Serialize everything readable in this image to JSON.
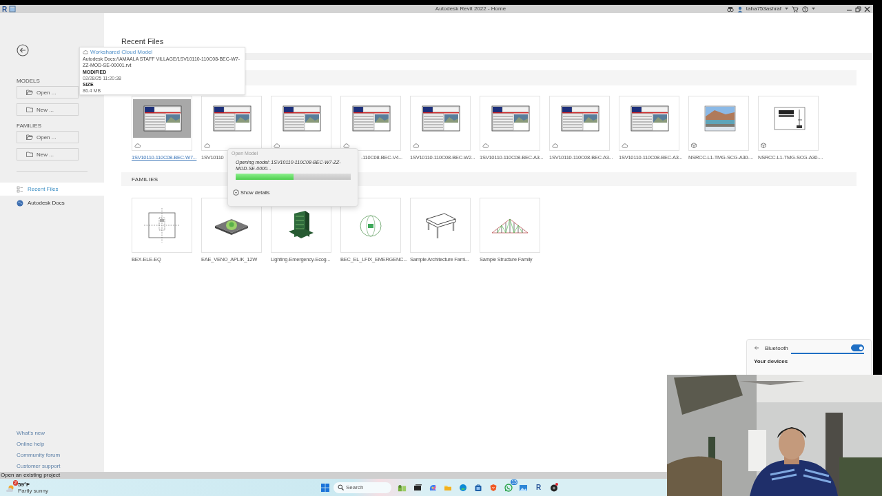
{
  "title_bar": {
    "app_icon": "R",
    "title": "Autodesk Revit 2022 - Home",
    "user": "taha753ashraf"
  },
  "sidebar": {
    "sections": [
      {
        "heading": "MODELS",
        "buttons": [
          {
            "label": "Open ...",
            "kind": "open"
          },
          {
            "label": "New ...",
            "kind": "new"
          }
        ]
      },
      {
        "heading": "FAMILIES",
        "buttons": [
          {
            "label": "Open ...",
            "kind": "open"
          },
          {
            "label": "New ...",
            "kind": "new"
          }
        ]
      }
    ],
    "nav": [
      {
        "label": "Recent Files",
        "selected": true,
        "kind": "recent"
      },
      {
        "label": "Autodesk Docs",
        "selected": false,
        "kind": "docs"
      }
    ],
    "links": [
      "What's new",
      "Online help",
      "Community forum",
      "Customer support"
    ]
  },
  "main": {
    "title": "Recent Files",
    "models": [
      {
        "label": "1SV10110-110C08-BEC-W7...",
        "selected": true,
        "kind": "sheet",
        "cloud": true
      },
      {
        "label": "1SV10110",
        "selected": false,
        "kind": "sheet",
        "cloud": true
      },
      {
        "selected": false,
        "kind": "sheet",
        "cloud": true
      },
      {
        "label": "-110C08-BEC-V4...",
        "selected": false,
        "kind": "sheet",
        "cloud": true
      },
      {
        "label": "1SV10110-110C08-BEC-W2...",
        "selected": false,
        "kind": "sheet",
        "cloud": true
      },
      {
        "label": "1SV10110-110C08-BEC-A3...",
        "selected": false,
        "kind": "sheet",
        "cloud": true
      },
      {
        "label": "1SV10110-110C08-BEC-A3...",
        "selected": false,
        "kind": "sheet",
        "cloud": true
      },
      {
        "label": "1SV10110-110C08-BEC-A3...",
        "selected": false,
        "kind": "sheet",
        "cloud": true
      },
      {
        "label": "NSRCC-L1-TMG-SCG-A30-...",
        "selected": false,
        "kind": "render",
        "cloud": false
      },
      {
        "label": "NSRCC-L1-TMG-SCG-A30-...",
        "selected": false,
        "kind": "drawing",
        "cloud": false
      }
    ],
    "families_heading": "FAMILIES",
    "families": [
      {
        "label": "BEX-ELE-EQ",
        "kind": "plan"
      },
      {
        "label": "EAE_VENO_APLIK_12W",
        "kind": "plate"
      },
      {
        "label": "Lighting-Emergency-Ecog...",
        "kind": "panel"
      },
      {
        "label": "BEC_EL_LFIX_EMERGENC...",
        "kind": "ring"
      },
      {
        "label": "Sample Architecture Fami...",
        "kind": "table"
      },
      {
        "label": "Sample Structure Family",
        "kind": "truss"
      }
    ]
  },
  "tooltip": {
    "title": "Workshared Cloud Model",
    "path": "Autodesk Docs://AMAALA STAFF VILLAGE/1SV10110-110C08-BEC-W7-ZZ-MOD-SE-00001.rvt",
    "fields": [
      {
        "label": "MODIFIED",
        "value": "02/28/25 11:20:38"
      },
      {
        "label": "SIZE",
        "value": "86.4 MB"
      }
    ]
  },
  "dialog": {
    "title": "Open Model",
    "message": "Opening model: 1SV10110-110C08-BEC-W7-ZZ-MOD-SE-0000...",
    "level": 0.5,
    "details": "Show details"
  },
  "bluetooth": {
    "title": "Bluetooth",
    "on": true,
    "subtitle": "Your devices"
  },
  "status_bar": "Open an existing project",
  "taskbar": {
    "weather": {
      "badge": "2",
      "temp": "59°F",
      "condition": "Partly sunny"
    },
    "search_placeholder": "Search",
    "apps": [
      {
        "kind": "widgets"
      },
      {
        "kind": "taskview"
      },
      {
        "kind": "copilot"
      },
      {
        "kind": "folder"
      },
      {
        "kind": "edge"
      },
      {
        "kind": "store"
      },
      {
        "kind": "brave"
      },
      {
        "kind": "whatsapp",
        "badge": "13"
      },
      {
        "kind": "photos"
      },
      {
        "kind": "letter",
        "text": "R"
      },
      {
        "kind": "recorder",
        "dot": true
      }
    ]
  }
}
